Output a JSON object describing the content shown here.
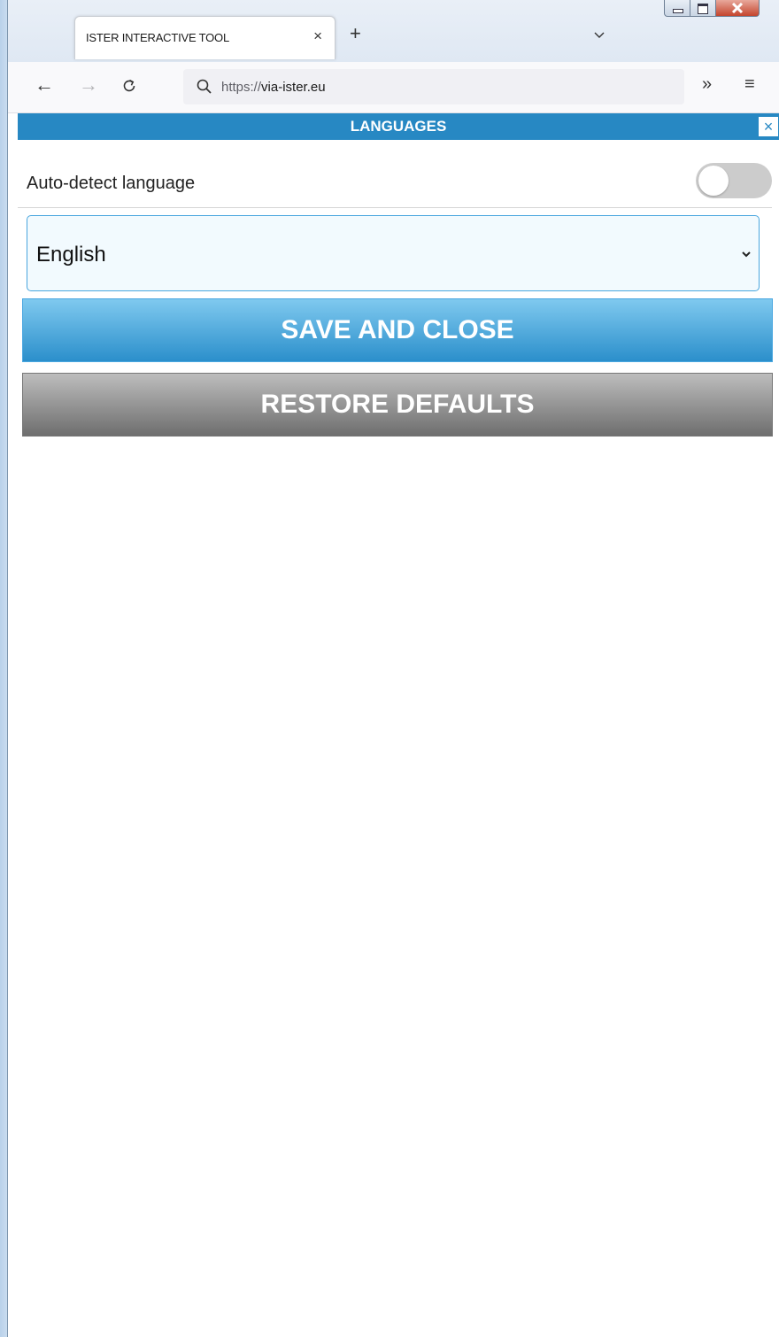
{
  "browser": {
    "tab_title": "ISTER INTERACTIVE TOOL",
    "tab_close": "×",
    "new_tab": "+",
    "url_protocol": "https://",
    "url_domain": "via-ister.eu",
    "icons": [
      "back-icon",
      "forward-icon",
      "reload-icon",
      "search-icon",
      "overflow-icon",
      "menu-icon",
      "tab-list-icon"
    ]
  },
  "dialog": {
    "title": "LANGUAGES",
    "close": "×",
    "auto_detect_label": "Auto-detect language",
    "auto_detect_enabled": false,
    "language_selected": "English",
    "save_label": "SAVE AND CLOSE",
    "restore_label": "RESTORE DEFAULTS"
  },
  "colors": {
    "header": "#2788c3",
    "save_button": "#2b8fcb",
    "restore_button": "#6e6e6e",
    "toggle_off": "#cccccc"
  }
}
